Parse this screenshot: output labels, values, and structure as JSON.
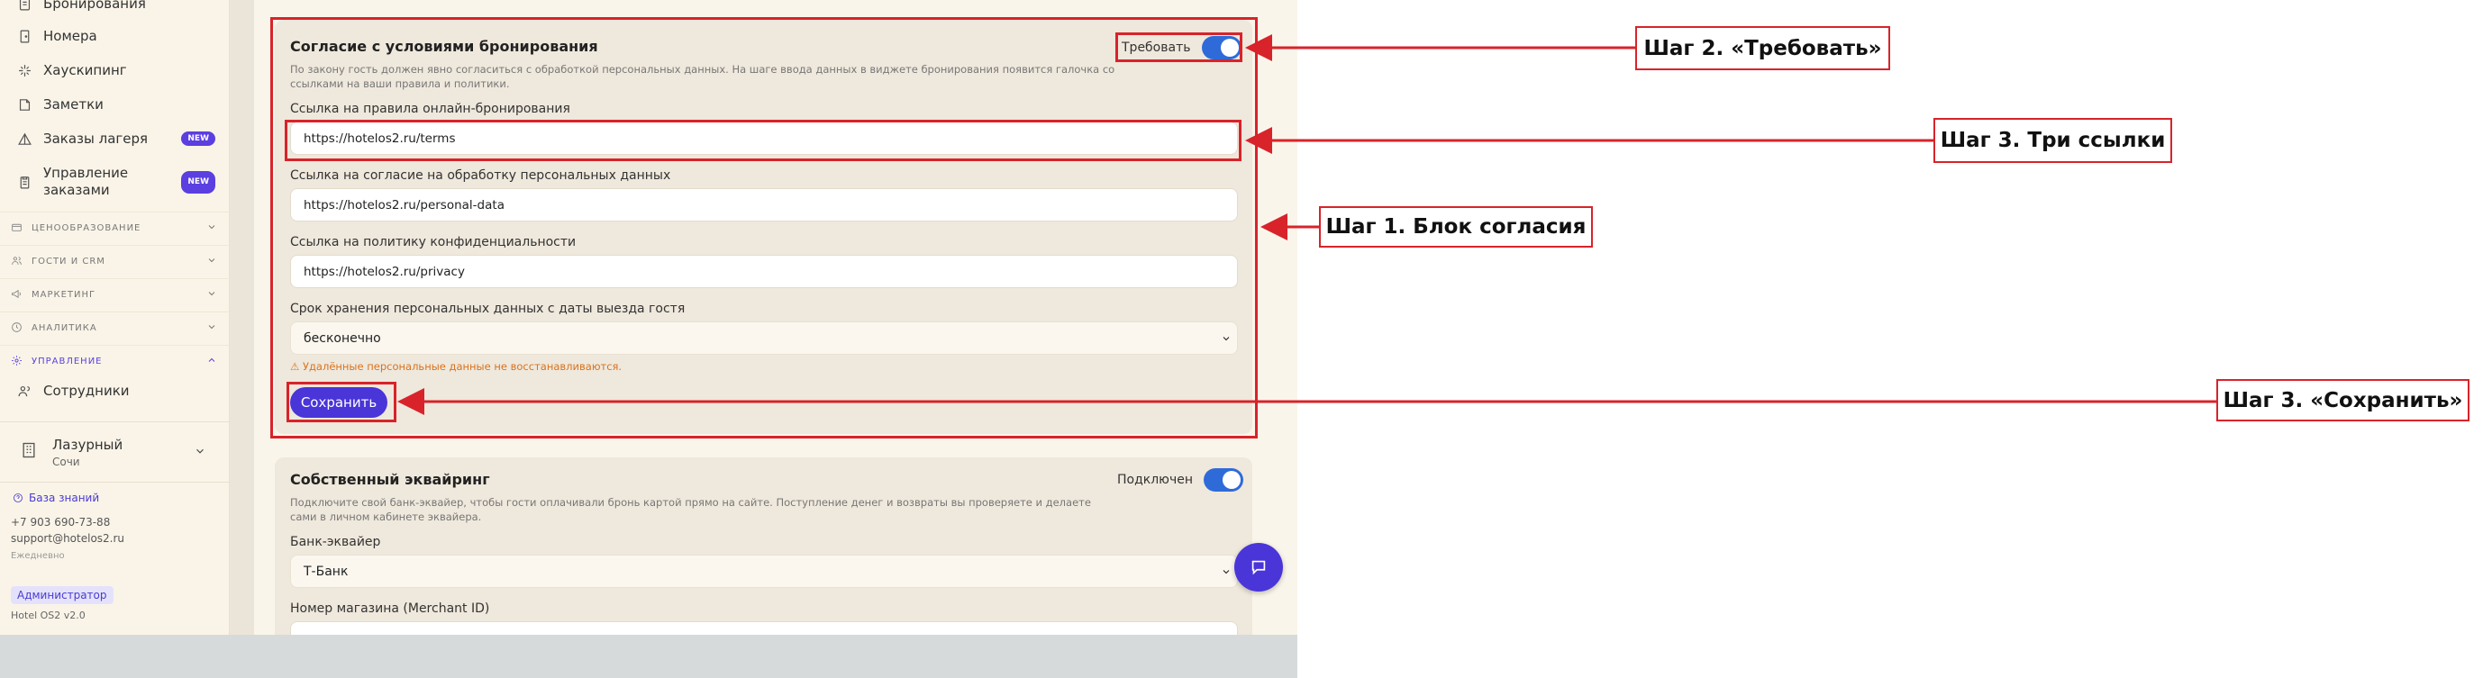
{
  "sidebar": {
    "items": [
      {
        "label": "Бронирования",
        "icon": "document-icon"
      },
      {
        "label": "Номера",
        "icon": "door-icon"
      },
      {
        "label": "Хаускипинг",
        "icon": "sparkle-icon"
      },
      {
        "label": "Заметки",
        "icon": "note-icon"
      },
      {
        "label": "Заказы лагеря",
        "icon": "tent-icon",
        "badge": "NEW"
      },
      {
        "label": "Управление заказами",
        "icon": "clipboard-icon",
        "badge": "NEW"
      }
    ],
    "sections": [
      {
        "label": "ЦЕНООБРАЗОВАНИЕ",
        "icon": "wallet-icon"
      },
      {
        "label": "ГОСТИ И CRM",
        "icon": "users-icon"
      },
      {
        "label": "МАРКЕТИНГ",
        "icon": "megaphone-icon"
      },
      {
        "label": "АНАЛИТИКА",
        "icon": "clock-icon"
      },
      {
        "label": "УПРАВЛЕНИЕ",
        "icon": "gear-icon"
      }
    ],
    "staff_item": "Сотрудники",
    "hotel": {
      "name": "Лазурный",
      "city": "Сочи"
    },
    "knowledge_base": "База знаний",
    "phone": "+7 903 690-73-88",
    "email": "support@hotelos2.ru",
    "hours": "Ежедневно",
    "role": "Администратор",
    "version": "Hotel OS2 v2.0"
  },
  "consent_card": {
    "title": "Согласие с условиями бронирования",
    "description": "По закону гость должен явно согласиться с обработкой персональных данных. На шаге ввода данных в виджете бронирования появится галочка со ссылками на ваши правила и политики.",
    "toggle_label": "Требовать",
    "fields": [
      {
        "label": "Ссылка на правила онлайн-бронирования",
        "value": "https://hotelos2.ru/terms"
      },
      {
        "label": "Ссылка на согласие на обработку персональных данных",
        "value": "https://hotelos2.ru/personal-data"
      },
      {
        "label": "Ссылка на политику конфиденциальности",
        "value": "https://hotelos2.ru/privacy"
      }
    ],
    "retention_label": "Срок хранения персональных данных с даты выезда гостя",
    "retention_value": "бесконечно",
    "warning": "⚠ Удалённые персональные данные не восстанавливаются.",
    "save_label": "Сохранить"
  },
  "acquiring_card": {
    "title": "Собственный эквайринг",
    "description": "Подключите свой банк-эквайер, чтобы гости оплачивали бронь картой прямо на сайте. Поступление денег и возвраты вы проверяете и делаете сами в личном кабинете эквайера.",
    "toggle_label": "Подключен",
    "bank_label": "Банк-эквайер",
    "bank_value": "Т-Банк",
    "merchant_label": "Номер магазина (Merchant ID)"
  },
  "annotations": {
    "step2": "Шаг 2. «Требовать»",
    "step3_links": "Шаг 3. Три ссылки",
    "step1": "Шаг 1. Блок согласия",
    "step3_save": "Шаг 3. «Сохранить»"
  },
  "colors": {
    "accent": "#4a35d8",
    "annotation": "#d8232a",
    "toggle_on": "#2f6bd8",
    "warning": "#d9731e"
  }
}
